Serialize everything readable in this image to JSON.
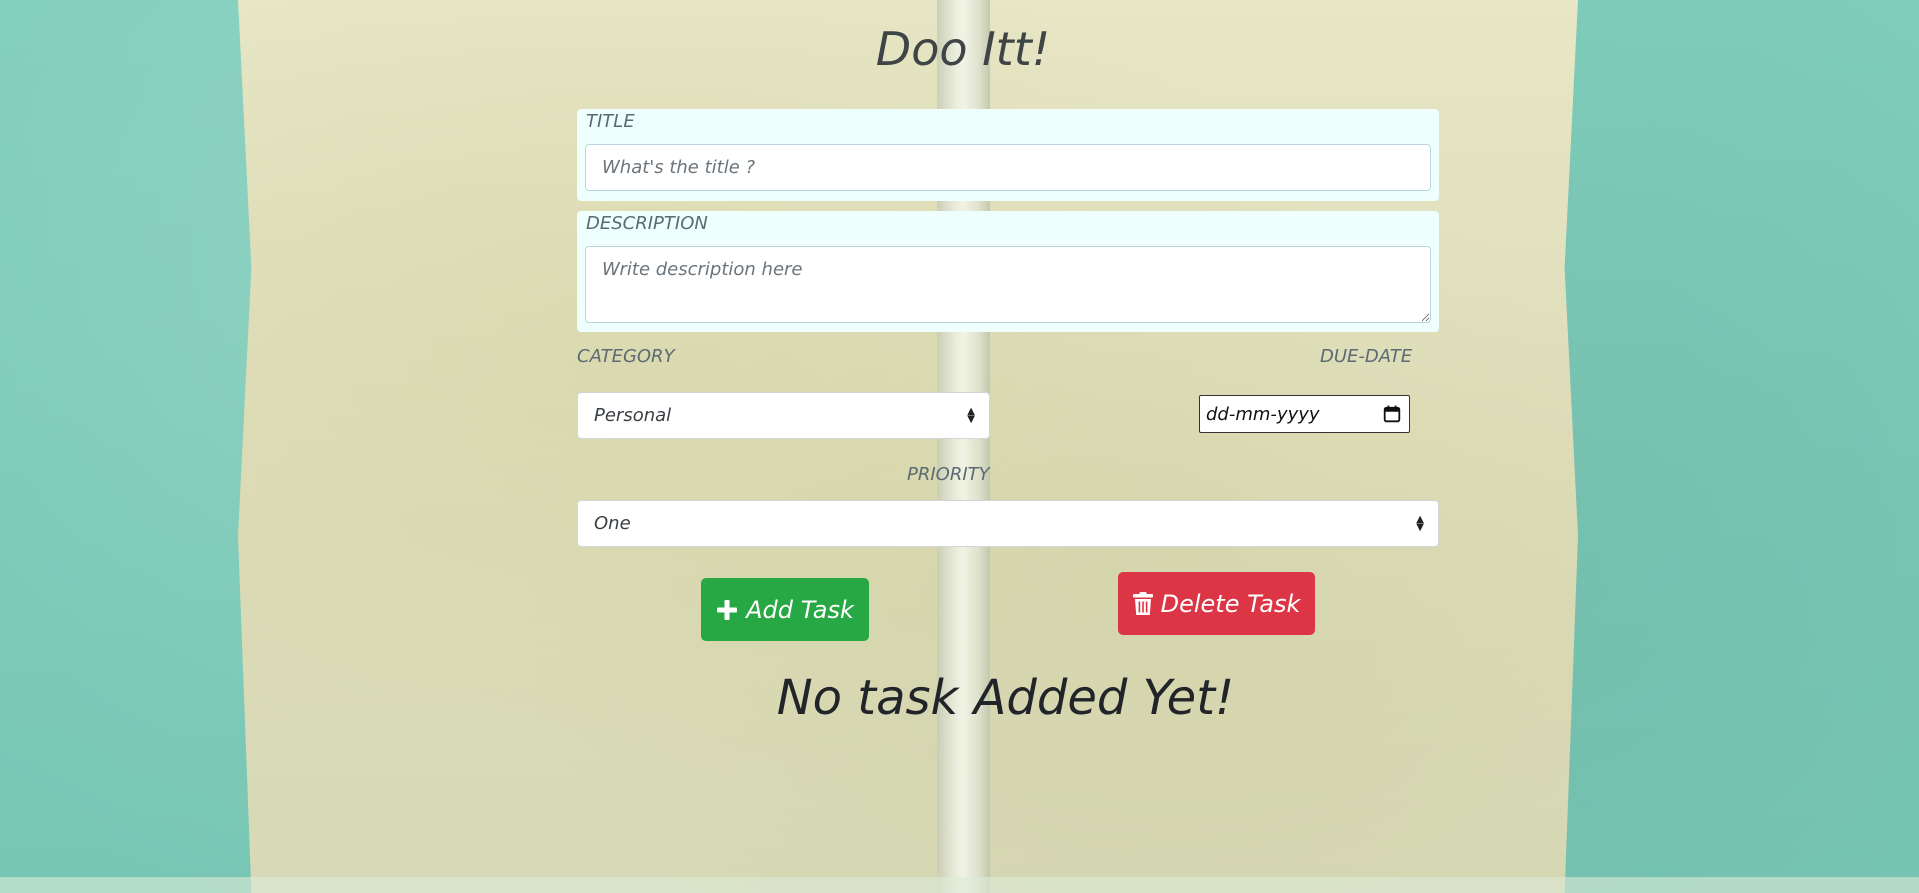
{
  "app": {
    "title": "Doo Itt!"
  },
  "form": {
    "title": {
      "label": "TITLE",
      "placeholder": "What's the title ?"
    },
    "description": {
      "label": "DESCRIPTION",
      "placeholder": "Write description here"
    },
    "category": {
      "label": "CATEGORY",
      "selected": "Personal"
    },
    "due_date": {
      "label": "DUE-DATE",
      "value": "dd-mm-yyyy",
      "icon": "calendar-icon"
    },
    "priority": {
      "label": "PRIORITY",
      "selected": "One"
    }
  },
  "actions": {
    "add": {
      "label": "Add Task",
      "icon": "plus-icon",
      "color": "#28a745"
    },
    "delete": {
      "label": "Delete Task",
      "icon": "trash-icon",
      "color": "#dc3545"
    }
  },
  "tasks": {
    "empty_message": "No task Added Yet!"
  },
  "colors": {
    "panel": "#effffd",
    "background_teal": "#7ecbb9",
    "wall": "#e2e2c0"
  }
}
